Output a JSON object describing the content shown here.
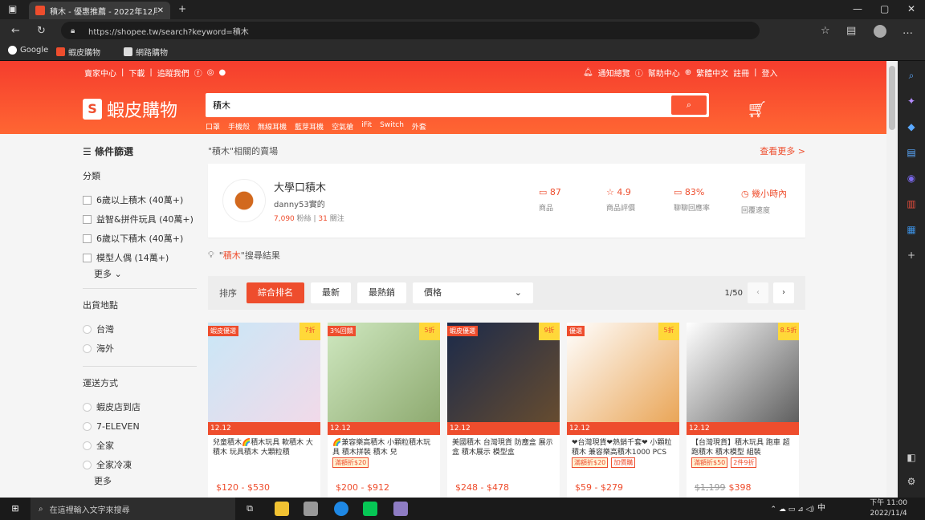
{
  "browser": {
    "tab_title": "積木 - 優惠推薦 - 2022年12月| 蝦",
    "url": "https://shopee.tw/search?keyword=積木",
    "bookmarks": [
      "Google",
      "蝦皮購物",
      "網路購物"
    ]
  },
  "header": {
    "top_left": [
      "賣家中心",
      "下載",
      "追蹤我們"
    ],
    "top_right": [
      "通知總覽",
      "幫助中心",
      "繁體中文",
      "註冊",
      "登入"
    ],
    "logo": "蝦皮購物",
    "search_value": "積木",
    "hot_keywords": [
      "口罩",
      "手機殼",
      "無線耳機",
      "藍芽耳機",
      "空氣槍",
      "iFit",
      "Switch",
      "外套"
    ]
  },
  "filter": {
    "title": "條件篩選",
    "cat_title": "分類",
    "categories": [
      "6歲以上積木 (40萬+)",
      "益智&拼件玩具 (40萬+)",
      "6歲以下積木 (40萬+)",
      "模型人偶 (14萬+)"
    ],
    "more": "更多",
    "loc_title": "出貨地點",
    "locations": [
      "台灣",
      "海外"
    ],
    "ship_title": "運送方式",
    "shipping": [
      "蝦皮店到店",
      "7-ELEVEN",
      "全家",
      "全家冷凍"
    ],
    "more2": "更多"
  },
  "shop": {
    "header": "\"積木\"相關的賣場",
    "more": "查看更多 >",
    "name": "大學口積木",
    "id": "danny53實的",
    "followers": "7,090",
    "followers_label": "粉絲",
    "following": "31",
    "following_label": "關注",
    "stats": [
      {
        "v": "87",
        "l": "商品"
      },
      {
        "v": "4.9",
        "l": "商品評價"
      },
      {
        "v": "83%",
        "l": "聊聊回應率"
      },
      {
        "v": "幾小時內",
        "l": "回覆速度"
      }
    ]
  },
  "results": {
    "kw": "積木",
    "rest": "搜尋結果"
  },
  "sortbar": {
    "label": "排序",
    "buttons": [
      "綜合排名",
      "最新",
      "最熱銷"
    ],
    "price": "價格",
    "page": "1/50"
  },
  "products": [
    {
      "badge": "蝦皮優選",
      "disc": "7折",
      "promo": "12.12",
      "title": "兒童積木🌈積木玩具 軟積木 大積木 玩具積木 大顆粒積",
      "tags": [],
      "price": "$120 - $530",
      "orig": ""
    },
    {
      "badge": "3%回饋",
      "disc": "5折",
      "promo": "12.12",
      "title": "🌈兼容樂高積木 小顆粒積木玩具 積木拼裝 積木 兒",
      "tags": [
        "滿額折$20"
      ],
      "price": "$200 - $912",
      "orig": ""
    },
    {
      "badge": "蝦皮優選",
      "disc": "9折",
      "promo": "12.12",
      "title": "美國積木 台灣現貨 防塵盒 展示盒 積木展示 模型盒",
      "tags": [],
      "price": "$248 - $478",
      "orig": ""
    },
    {
      "badge": "優選",
      "disc": "5折",
      "promo": "12.12",
      "title": "❤台灣現貨❤熱銷千套❤ 小顆粒 積木 兼容樂高積木1000 PCS",
      "tags": [
        "滿額折$20",
        "加價購"
      ],
      "price": "$59 - $279",
      "orig": ""
    },
    {
      "badge": "",
      "disc": "8.5折",
      "promo": "12.12",
      "title": "【台灣現貨】積木玩具 跑車 超跑積木 積木模型 組裝",
      "tags": [
        "滿額折$50",
        "2件9折"
      ],
      "price": "$398",
      "orig": "$1,199"
    }
  ],
  "taskbar": {
    "search": "在這裡輸入文字來搜尋",
    "time": "下午 11:00",
    "date": "2022/11/4",
    "ime": "中"
  }
}
